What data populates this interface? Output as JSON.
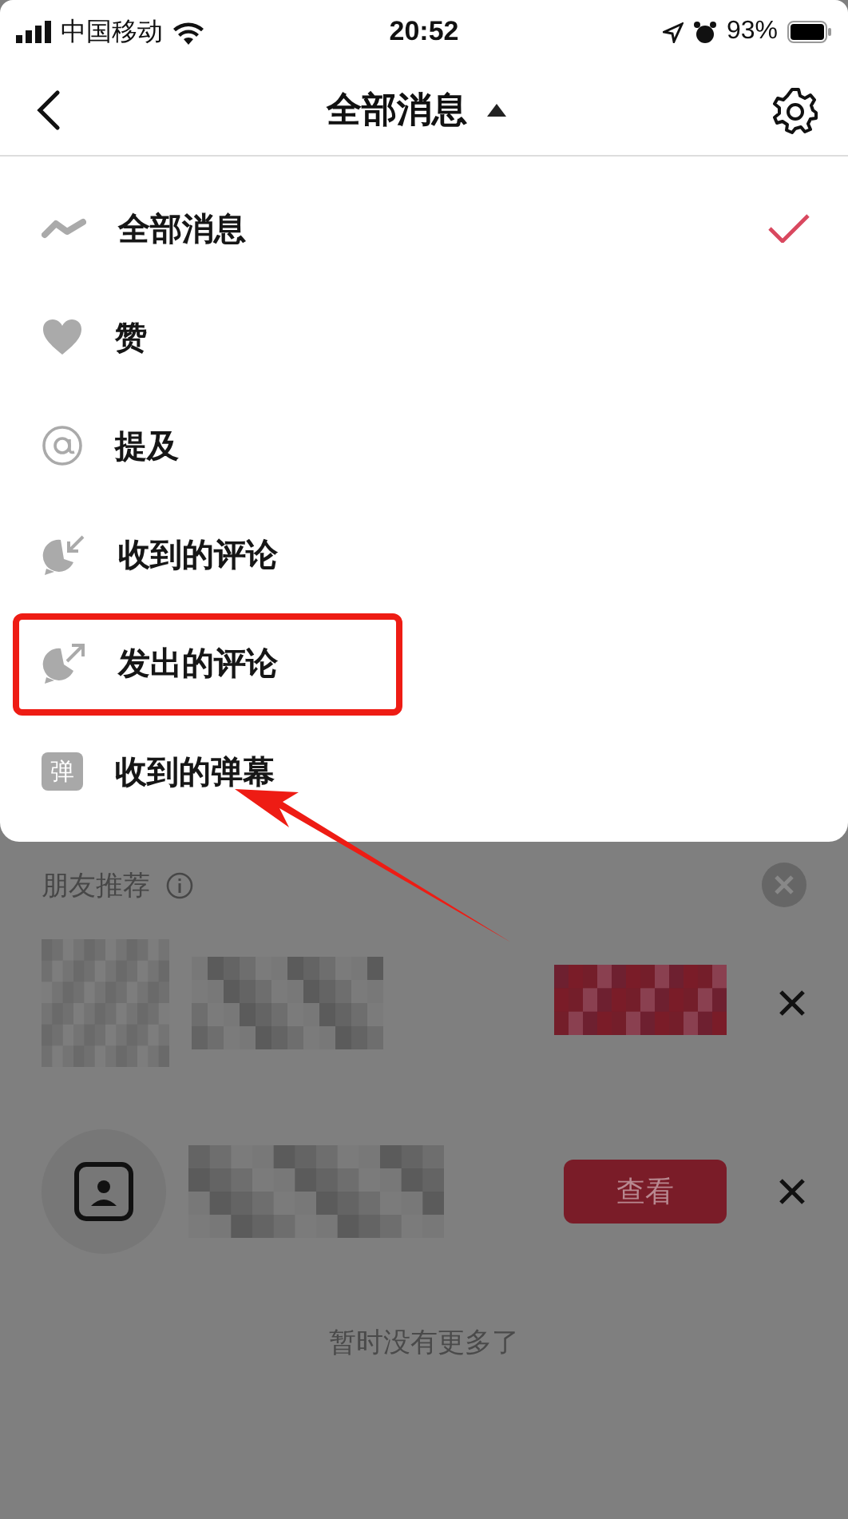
{
  "status_bar": {
    "carrier": "中国移动",
    "time": "20:52",
    "battery": "93%"
  },
  "nav": {
    "title": "全部消息",
    "expanded": true
  },
  "menu": [
    {
      "kind": "all",
      "label": "全部消息",
      "selected": true,
      "highlighted": false
    },
    {
      "kind": "like",
      "label": "赞",
      "selected": false,
      "highlighted": false
    },
    {
      "kind": "mention",
      "label": "提及",
      "selected": false,
      "highlighted": false
    },
    {
      "kind": "received_comment",
      "label": "收到的评论",
      "selected": false,
      "highlighted": false
    },
    {
      "kind": "sent_comment",
      "label": "发出的评论",
      "selected": false,
      "highlighted": true
    },
    {
      "kind": "danmaku",
      "label": "收到的弹幕",
      "icon_text": "弹",
      "selected": false,
      "highlighted": false
    }
  ],
  "friends": {
    "title": "朋友推荐",
    "items": [
      {
        "kind": "blurred"
      },
      {
        "kind": "contact",
        "button": "查看"
      }
    ]
  },
  "end_note": "暂时没有更多了"
}
